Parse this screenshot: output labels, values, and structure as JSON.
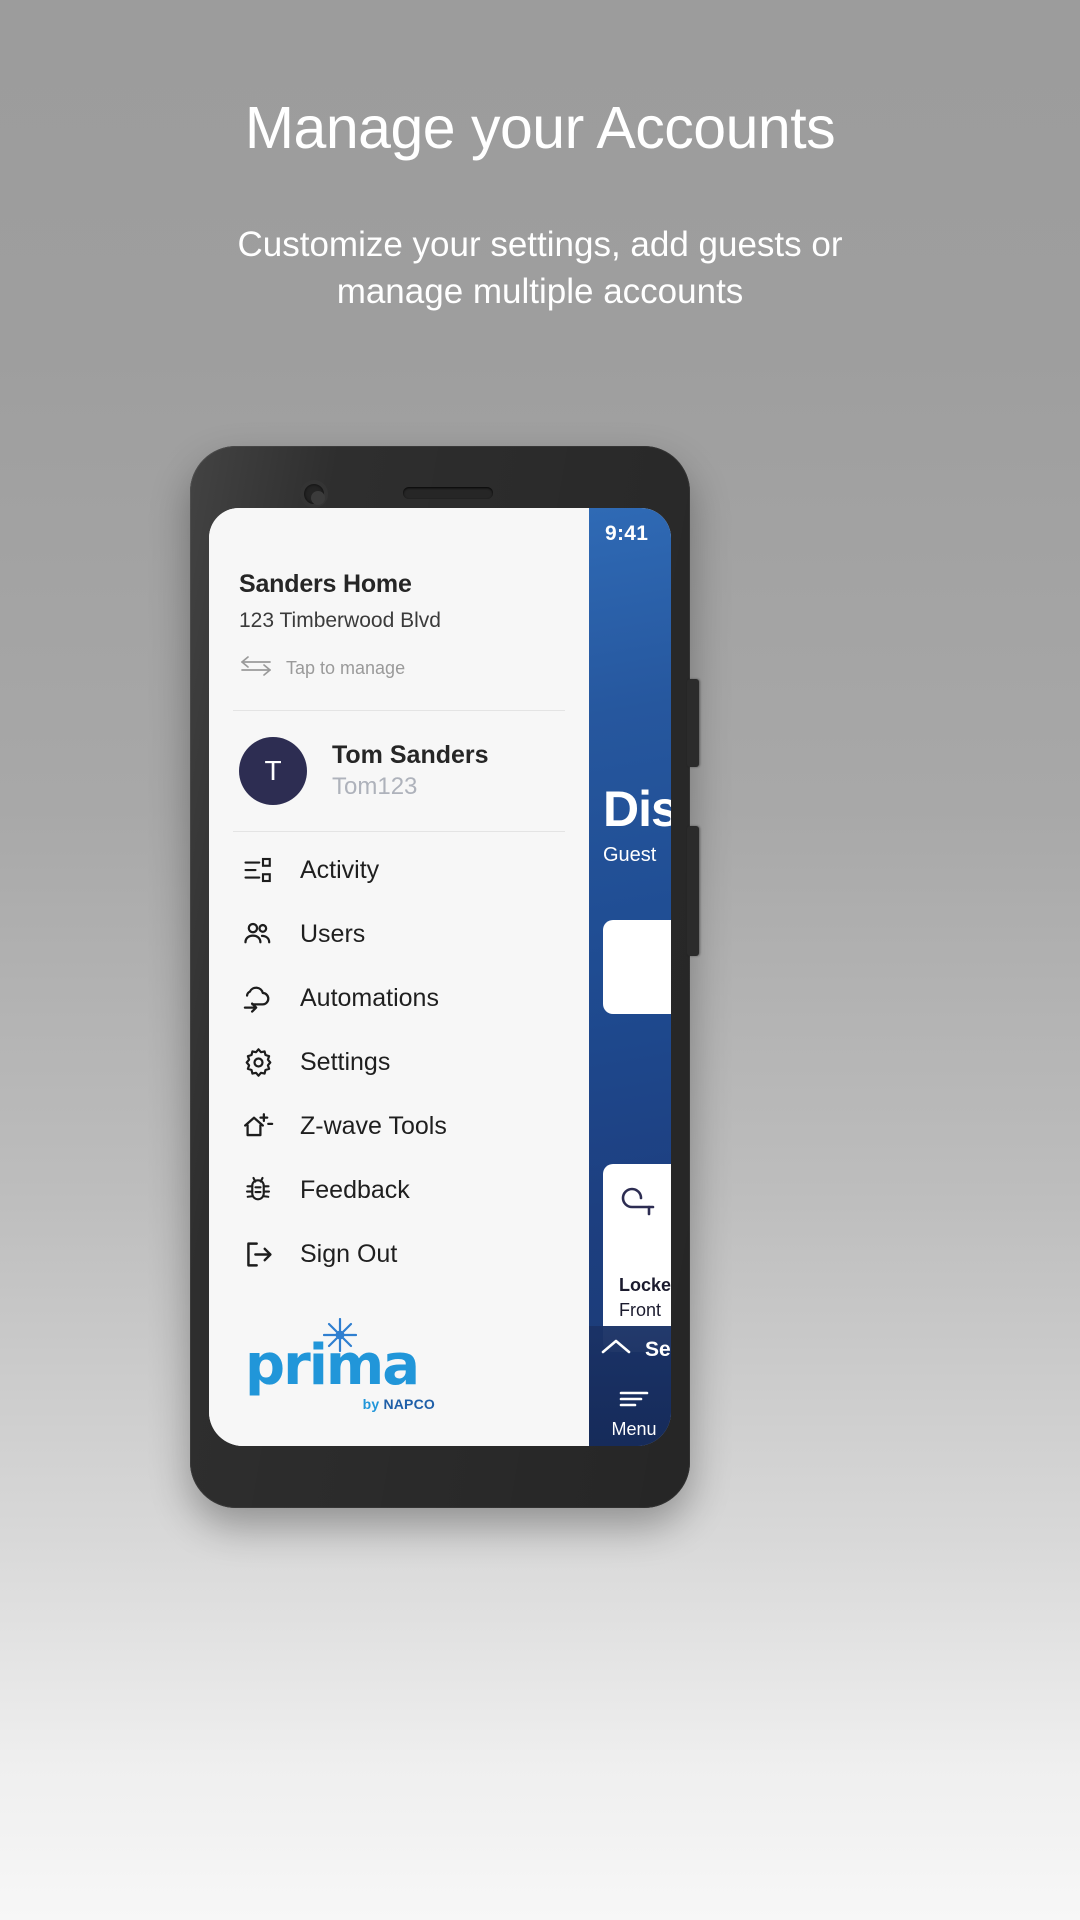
{
  "promo": {
    "title": "Manage your Accounts",
    "subtitle": "Customize your settings, add guests or manage multiple accounts"
  },
  "colors": {
    "background_top": "#9c9c9c",
    "background_bottom": "#f7f7f7",
    "phone_frame": "#2e2e2e",
    "drawer_bg": "#f7f7f7",
    "avatar_bg": "#2d2d52",
    "dashboard_blue_top": "#2f6ab5",
    "dashboard_blue_bottom": "#1b3a74",
    "logo_blue": "#2196d9",
    "logo_sub_blue": "#1f5fa8",
    "muted_text": "#9a9a9a"
  },
  "drawer": {
    "home": {
      "name": "Sanders Home",
      "address": "123 Timberwood Blvd",
      "manage_label": "Tap to manage",
      "manage_icon": "swap-arrows-icon"
    },
    "user": {
      "avatar_initial": "T",
      "name": "Tom Sanders",
      "handle": "Tom123"
    },
    "menu_items": [
      {
        "label": "Activity",
        "icon": "activity-list-icon"
      },
      {
        "label": "Users",
        "icon": "users-icon"
      },
      {
        "label": "Automations",
        "icon": "automation-cloud-icon"
      },
      {
        "label": "Settings",
        "icon": "gear-icon"
      },
      {
        "label": "Z-wave Tools",
        "icon": "home-plus-minus-icon"
      },
      {
        "label": "Feedback",
        "icon": "bug-icon"
      },
      {
        "label": "Sign Out",
        "icon": "sign-out-icon"
      }
    ],
    "logo": {
      "word": "prima",
      "by": "by ",
      "brand": "NAPCO",
      "star_icon": "sparkle-star-icon"
    }
  },
  "dashboard": {
    "status_time": "9:41",
    "title": "Dis",
    "subtitle": "Guest",
    "lock_card": {
      "icon": "lock-icon",
      "label": "Locke",
      "sublabel": "Front"
    },
    "sheet_handle_label": "Se",
    "sheet_handle_icon": "chevron-up-icon",
    "menu_label": "Menu",
    "menu_icon": "hamburger-lines-icon"
  }
}
